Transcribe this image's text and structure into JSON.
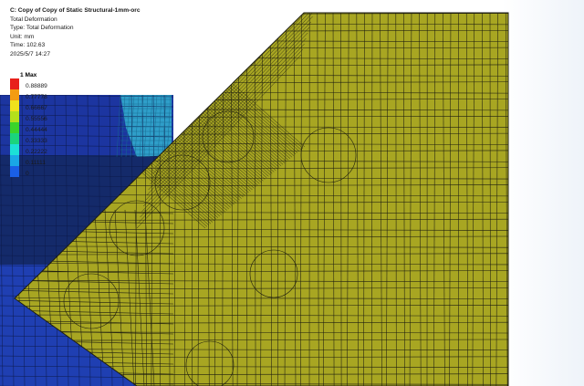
{
  "result": {
    "title": "C: Copy of Copy of Static Structural-1mm-orc",
    "subtitle": "Total Deformation",
    "type": "Type: Total Deformation",
    "unit": "Unit: mm",
    "time": "Time: 102.63",
    "date": "2025/5/7 14:27"
  },
  "legend": {
    "max_label": "1 Max",
    "bands": [
      {
        "color": "#e8201b",
        "value": "0.88889"
      },
      {
        "color": "#f39c12",
        "value": "0.77778"
      },
      {
        "color": "#f1e21c",
        "value": "0.66667"
      },
      {
        "color": "#b4e01c",
        "value": "0.55556"
      },
      {
        "color": "#3bd42b",
        "value": "0.44444"
      },
      {
        "color": "#1bd47d",
        "value": "0.33333"
      },
      {
        "color": "#1ce0d7",
        "value": "0.22222"
      },
      {
        "color": "#1aa7e6",
        "value": "0.11111"
      },
      {
        "color": "#1a5fe6",
        "value": "0"
      }
    ]
  },
  "colors": {
    "part_main": "#a8a622",
    "part_dark": "#142a6a",
    "part_blue": "#1f3fb2",
    "part_cyan": "#2f9ec9",
    "mesh_line": "#1e1e10"
  }
}
